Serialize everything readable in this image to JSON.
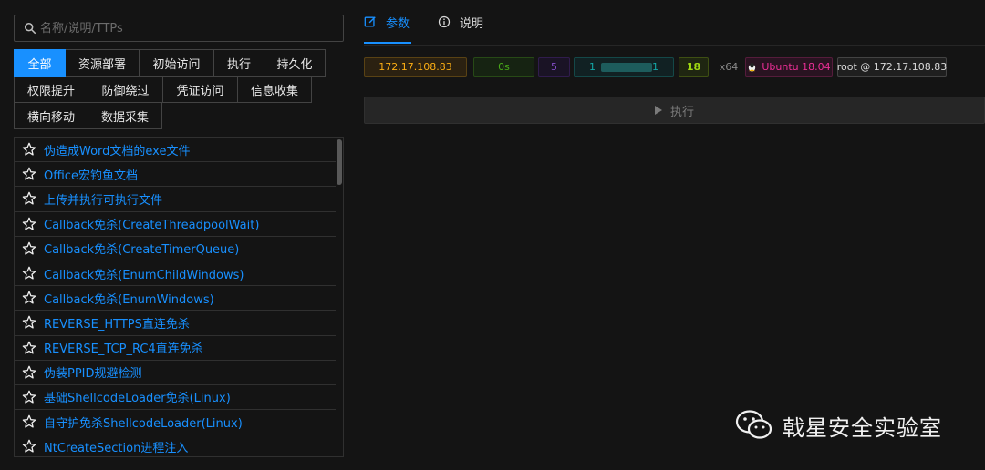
{
  "search": {
    "placeholder": "名称/说明/TTPs"
  },
  "tags": {
    "rows": [
      [
        "全部",
        "资源部署",
        "初始访问",
        "执行",
        "持久化"
      ],
      [
        "权限提升",
        "防御绕过",
        "凭证访问",
        "信息收集"
      ],
      [
        "横向移动",
        "数据采集"
      ]
    ],
    "active": "全部"
  },
  "list": {
    "items": [
      "伪造成Word文档的exe文件",
      "Office宏钓鱼文档",
      "上传并执行可执行文件",
      "Callback免杀(CreateThreadpoolWait)",
      "Callback免杀(CreateTimerQueue)",
      "Callback免杀(EnumChildWindows)",
      "Callback免杀(EnumWindows)",
      "REVERSE_HTTPS直连免杀",
      "REVERSE_TCP_RC4直连免杀",
      "伪装PPID规避检测",
      "基础ShellcodeLoader免杀(Linux)",
      "自守护免杀ShellcodeLoader(Linux)",
      "NtCreateSection进程注入"
    ]
  },
  "tabs": {
    "params": "参数",
    "desc": "说明"
  },
  "badges": {
    "ip": "172.17.108.83",
    "time": "0s",
    "num": "5",
    "host_prefix": "1",
    "host_suffix": "1",
    "level": "18",
    "arch": "x64",
    "os": "Ubuntu 18.04",
    "user": "root @ 172.17.108.83"
  },
  "exec": {
    "label": "执行"
  },
  "watermark": {
    "text": "戟星安全实验室"
  },
  "colors": {
    "accent": "#1890ff",
    "background": "#141414"
  }
}
